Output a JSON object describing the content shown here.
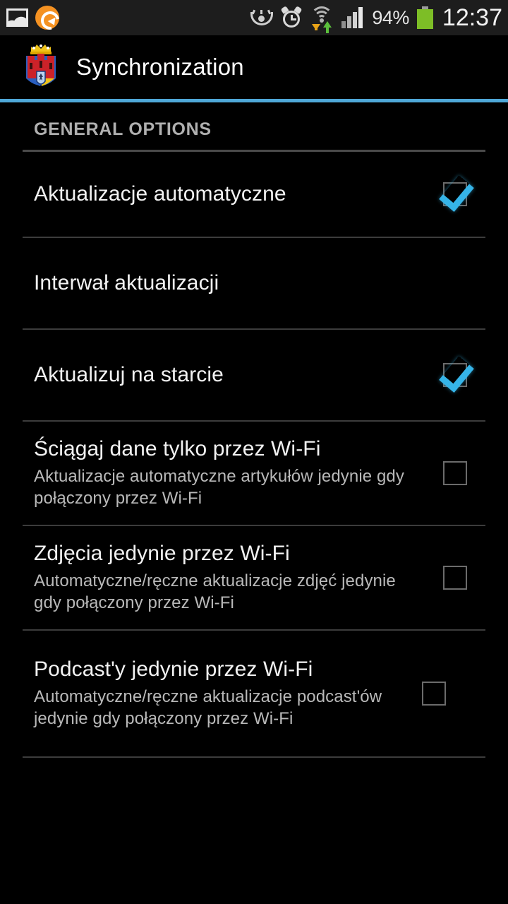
{
  "status_bar": {
    "left_icons": [
      {
        "name": "gallery-icon",
        "label": "Gallery"
      },
      {
        "name": "sync-icon",
        "label": "Sync"
      }
    ],
    "right_icons": [
      {
        "name": "smart-stay-eye-icon",
        "label": "Smart stay"
      },
      {
        "name": "alarm-clock-icon",
        "label": "Alarm"
      },
      {
        "name": "wifi-icon",
        "label": "Wi-Fi with data transfer"
      },
      {
        "name": "cellular-signal-icon",
        "label": "Signal"
      }
    ],
    "battery_percent": "94%",
    "battery_icon": "battery-icon",
    "time": "12:37"
  },
  "action_bar": {
    "app_icon": "krakow-coat-of-arms-icon",
    "title": "Synchronization",
    "accent_color": "#4fa8d8"
  },
  "list": {
    "section_header": "GENERAL OPTIONS",
    "items": [
      {
        "title": "Aktualizacje automatyczne",
        "subtitle": "",
        "control": "checkbox",
        "checked": true
      },
      {
        "title": "Interwał aktualizacji",
        "subtitle": "",
        "control": "none",
        "checked": false
      },
      {
        "title": "Aktualizuj na starcie",
        "subtitle": "",
        "control": "checkbox",
        "checked": true
      },
      {
        "title": "Ściągaj dane tylko przez Wi-Fi",
        "subtitle": "Aktualizacje automatyczne artykułów jedynie gdy połączony przez Wi-Fi",
        "control": "checkbox",
        "checked": false
      },
      {
        "title": "Zdjęcia jedynie przez Wi-Fi",
        "subtitle": "Automatyczne/ręczne aktualizacje zdjęć jedynie gdy połączony przez Wi-Fi",
        "control": "checkbox",
        "checked": false
      },
      {
        "title": "Podcast'y jedynie przez Wi-Fi",
        "subtitle": "Automatyczne/ręczne aktualizacje podcast'ów jedynie gdy połączony przez Wi-Fi",
        "control": "checkbox",
        "checked": false
      }
    ]
  },
  "colors": {
    "background": "#000000",
    "status_bar_bg": "#1d1d1d",
    "accent": "#4fa8d8",
    "checkbox_check": "#35b4e8",
    "divider": "#3c3c3c",
    "primary_text": "#f2f2f2",
    "secondary_text": "#b9b9b9"
  }
}
